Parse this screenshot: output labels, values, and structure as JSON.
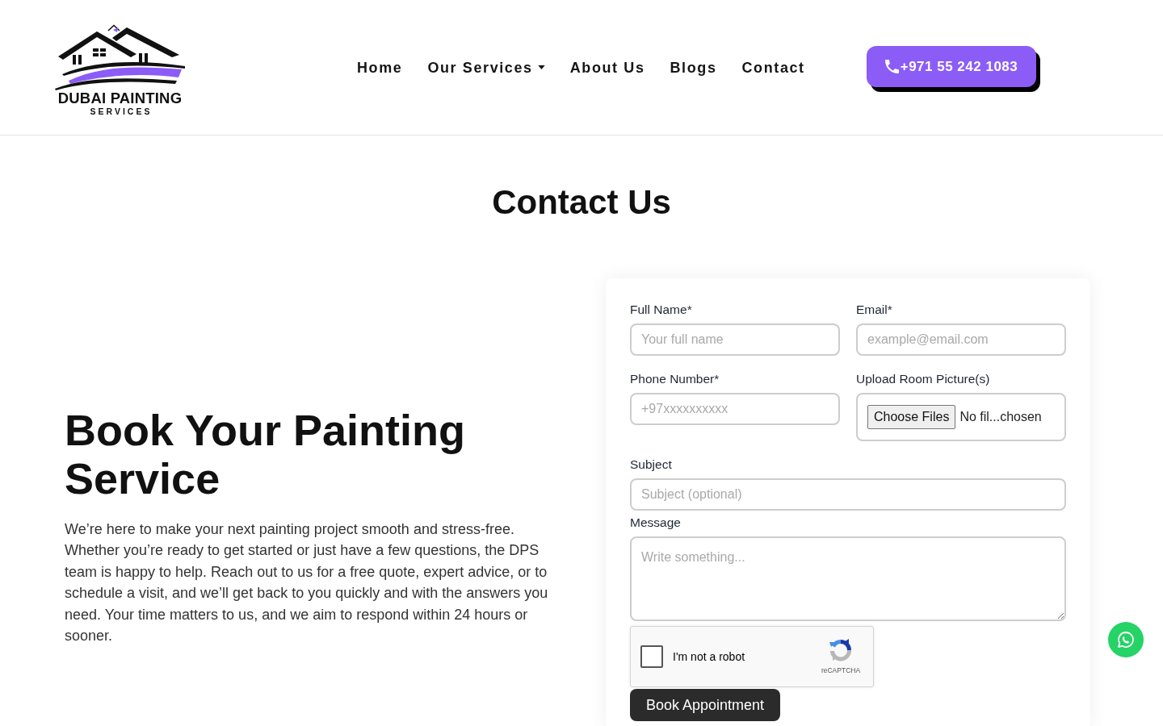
{
  "header": {
    "logo": {
      "name": "DUBAI PAINTING",
      "tagline": "SERVICES"
    },
    "nav": [
      {
        "label": "Home",
        "dropdown": false
      },
      {
        "label": "Our Services",
        "dropdown": true
      },
      {
        "label": "About Us",
        "dropdown": false
      },
      {
        "label": "Blogs",
        "dropdown": false
      },
      {
        "label": "Contact",
        "dropdown": false
      }
    ],
    "phone_button": "+971 55 242 1083"
  },
  "page_title": "Contact Us",
  "intro": {
    "heading": "Book Your Painting Service",
    "text": "We’re here to make your next painting project smooth and stress-free. Whether you’re ready to get started or just have a few questions, the DPS team is happy to help. Reach out to us for a free quote, expert advice, or to schedule a visit, and we’ll get back to you quickly and with the answers you need. Your time matters to us, and we aim to respond within 24 hours or sooner."
  },
  "form": {
    "rows": [
      [
        {
          "kind": "text",
          "label": "Full Name*",
          "placeholder": "Your full name"
        },
        {
          "kind": "text",
          "label": "Email*",
          "placeholder": "example@email.com"
        }
      ],
      [
        {
          "kind": "text",
          "label": "Phone Number*",
          "placeholder": "+97xxxxxxxxxx"
        },
        {
          "kind": "file",
          "label": "Upload Room Picture(s)",
          "button": "Choose Files",
          "value": "No fil...chosen"
        }
      ],
      [
        {
          "kind": "text",
          "label": "Subject",
          "placeholder": "Subject (optional)"
        }
      ],
      [
        {
          "kind": "textarea",
          "label": "Message",
          "placeholder": "Write something..."
        }
      ]
    ],
    "captcha": {
      "label": "I'm not a robot",
      "checked": false,
      "brand": "reCAPTCHA"
    },
    "submit": "Book Appointment"
  }
}
